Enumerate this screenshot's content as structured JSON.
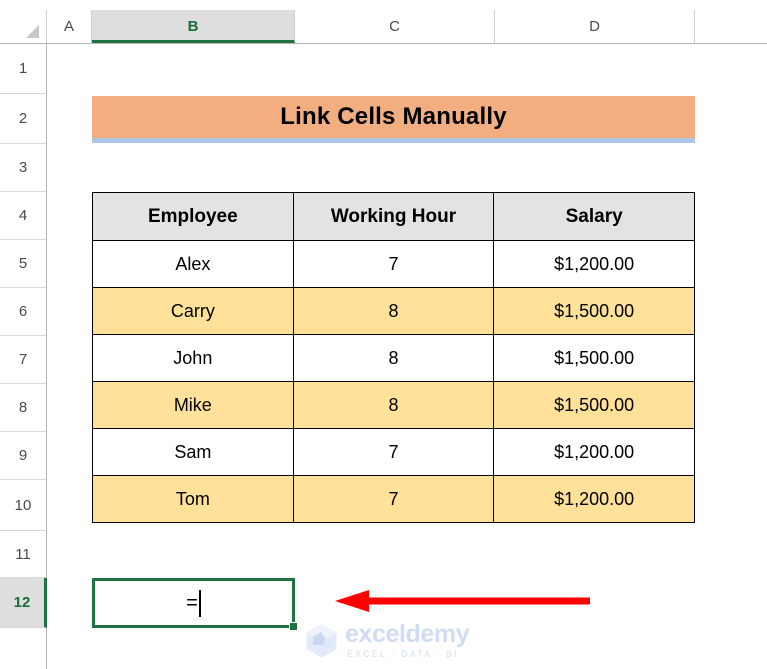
{
  "app": "excel-spreadsheet",
  "grid": {
    "column_headers": [
      "A",
      "B",
      "C",
      "D"
    ],
    "selected_column": "B",
    "row_headers": [
      "1",
      "2",
      "3",
      "4",
      "5",
      "6",
      "7",
      "8",
      "9",
      "10",
      "11",
      "12"
    ],
    "selected_row": "12",
    "corner_icon": "select-all-triangle-icon"
  },
  "title_banner": {
    "text": "Link Cells Manually",
    "fill_color": "#F2AE80",
    "underline_color": "#ADC6E5"
  },
  "table": {
    "headers": [
      "Employee",
      "Working Hour",
      "Salary"
    ],
    "header_fill": "#E3E3E3",
    "rows": [
      {
        "employee": "Alex",
        "hours": "7",
        "salary": "$1,200.00",
        "fill": "white"
      },
      {
        "employee": "Carry",
        "hours": "8",
        "salary": "$1,500.00",
        "fill": "yellow"
      },
      {
        "employee": "John",
        "hours": "8",
        "salary": "$1,500.00",
        "fill": "white"
      },
      {
        "employee": "Mike",
        "hours": "8",
        "salary": "$1,500.00",
        "fill": "yellow"
      },
      {
        "employee": "Sam",
        "hours": "7",
        "salary": "$1,200.00",
        "fill": "white"
      },
      {
        "employee": "Tom",
        "hours": "7",
        "salary": "$1,200.00",
        "fill": "yellow"
      }
    ],
    "band_color": "#FFE19A"
  },
  "active_cell": {
    "reference": "B12",
    "value": "=",
    "border_color": "#207245",
    "has_caret": true,
    "fill_handle": "fill-handle"
  },
  "annotation": {
    "type": "red-arrow-left",
    "color": "#FF0000"
  },
  "watermark": {
    "name": "exceldemy",
    "tagline": "EXCEL · DATA · BI",
    "logo": "hexagon-logo-icon",
    "color": "#cfdcf3"
  }
}
